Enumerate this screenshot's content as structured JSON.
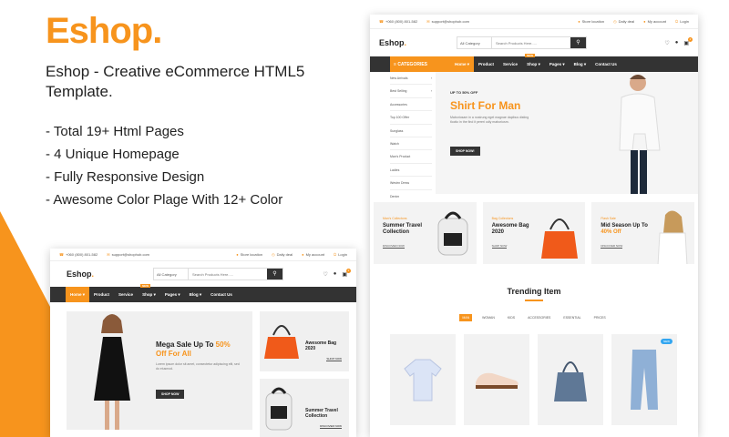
{
  "promo": {
    "brand": "Eshop.",
    "tagline": "Eshop - Creative eCommerce HTML5 Template.",
    "features": [
      "Total 19+ Html Pages",
      "4 Unique Homepage",
      "Fully Responsive Design",
      "Awesome Color Plage With 12+ Color"
    ]
  },
  "colors": {
    "accent": "#f7941d",
    "dark": "#333333",
    "light_bg": "#f5f5f5"
  },
  "topbar": {
    "phone": "+060 (800) 801-582",
    "email": "support@shophub.com",
    "store": "Store location",
    "deal": "Daily deal",
    "account": "My account",
    "login": "Login"
  },
  "header": {
    "logo": "Eshop",
    "logo_dot": ".",
    "search_category": "All Category",
    "search_placeholder": "Search Products Here.....",
    "cart_count": "2"
  },
  "nav": {
    "categories": "CATEGORIES",
    "items": [
      "Home",
      "Product",
      "Service",
      "Shop",
      "Pages",
      "Blog",
      "Contact Us"
    ],
    "new_badge": "NEW"
  },
  "categories": [
    "New Arrivals",
    "Best Selling",
    "Accessories",
    "Top 100 Offer",
    "Sunglass",
    "Watch",
    "Man's Product",
    "Ladies",
    "Westrn Dress",
    "Denim"
  ],
  "hero": {
    "pre": "UP TO 50% OFF",
    "title": "Shirt For Man",
    "desc": "Maboriosam in a nostrung eget magnae dapibus disting tloctio in the find it pereri odiy maboriosm.",
    "button": "SHOP NOW!"
  },
  "cards": [
    {
      "kicker": "Man's Collectons",
      "title": "Summer Travel Collection",
      "link": "DISCOVER NOW"
    },
    {
      "kicker": "Bag Collectons",
      "title": "Awesome Bag 2020",
      "link": "SHOP NOW"
    },
    {
      "kicker": "Flash Sale",
      "title_a": "Mid Season Up To ",
      "title_b": "40% Off",
      "link": "DISCOVER NOW"
    }
  ],
  "trending": {
    "title": "Trending Item",
    "tabs": [
      "MAN",
      "WOMAN",
      "KIDS",
      "ACCESSORIES",
      "ESSENTIAL",
      "PRICES"
    ],
    "new_badge": "NEW"
  },
  "home2": {
    "hero_title_a": "Mega Sale Up To ",
    "hero_title_b": "50% Off For All",
    "hero_desc": "Lorem ipsum dolor sit amet, consectetur adipiscing elit, sed do eiusmod.",
    "hero_button": "SHOP NOW",
    "side": [
      {
        "title": "Awesome Bag 2020",
        "link": "SHOP NOW"
      },
      {
        "title": "Summer Travel Collection",
        "link": "DISCOVER NOW"
      }
    ]
  }
}
